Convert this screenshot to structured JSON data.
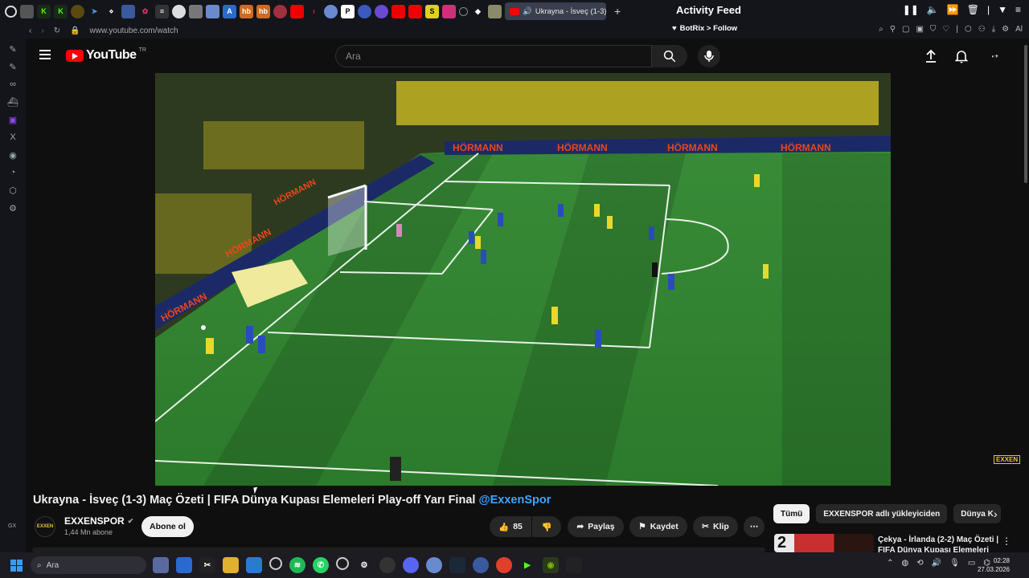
{
  "browser": {
    "active_tab_title": "Ukrayna - İsveç (1-3) M",
    "new_tab": "+",
    "url": "www.youtube.com/watch"
  },
  "activity_feed": {
    "title": "Activity Feed",
    "botrix_label": "BotRix > Follow",
    "ext_label": "Al"
  },
  "youtube": {
    "logo_text": "YouTube",
    "logo_region": "TR",
    "search_placeholder": "Ara"
  },
  "video": {
    "title_main": "Ukrayna - İsveç (1-3) Maç Özeti | FIFA Dünya Kupası Elemeleri Play-off Yarı Final",
    "title_tag": "@ExxenSpor",
    "watermark": "EXXEN",
    "ad_boards": [
      "HÖRMANN",
      "HÖRMANN",
      "HÖRMANN",
      "HÖRMANN",
      "HÖRMANN",
      "HÖRMANN",
      "HÖRMANN"
    ]
  },
  "channel": {
    "avatar_text": "EXXEN",
    "name": "EXXENSPOR",
    "subscribers": "1,44 Mn abone",
    "subscribe_label": "Abone ol"
  },
  "actions": {
    "likes": "85",
    "share": "Paylaş",
    "save": "Kaydet",
    "clip": "Klip"
  },
  "chips": [
    "Tümü",
    "EXXENSPOR adlı yükleyiciden",
    "Dünya K"
  ],
  "recommendation": {
    "thumb_number": "2",
    "title": "Çekya - İrlanda (2-2) Maç Özeti | FIFA Dünya Kupası Elemeleri"
  },
  "sidebar": {
    "gx_label": "GX"
  },
  "taskbar": {
    "search_placeholder": "Ara",
    "time": "02:28",
    "date": "27.03.2026"
  }
}
